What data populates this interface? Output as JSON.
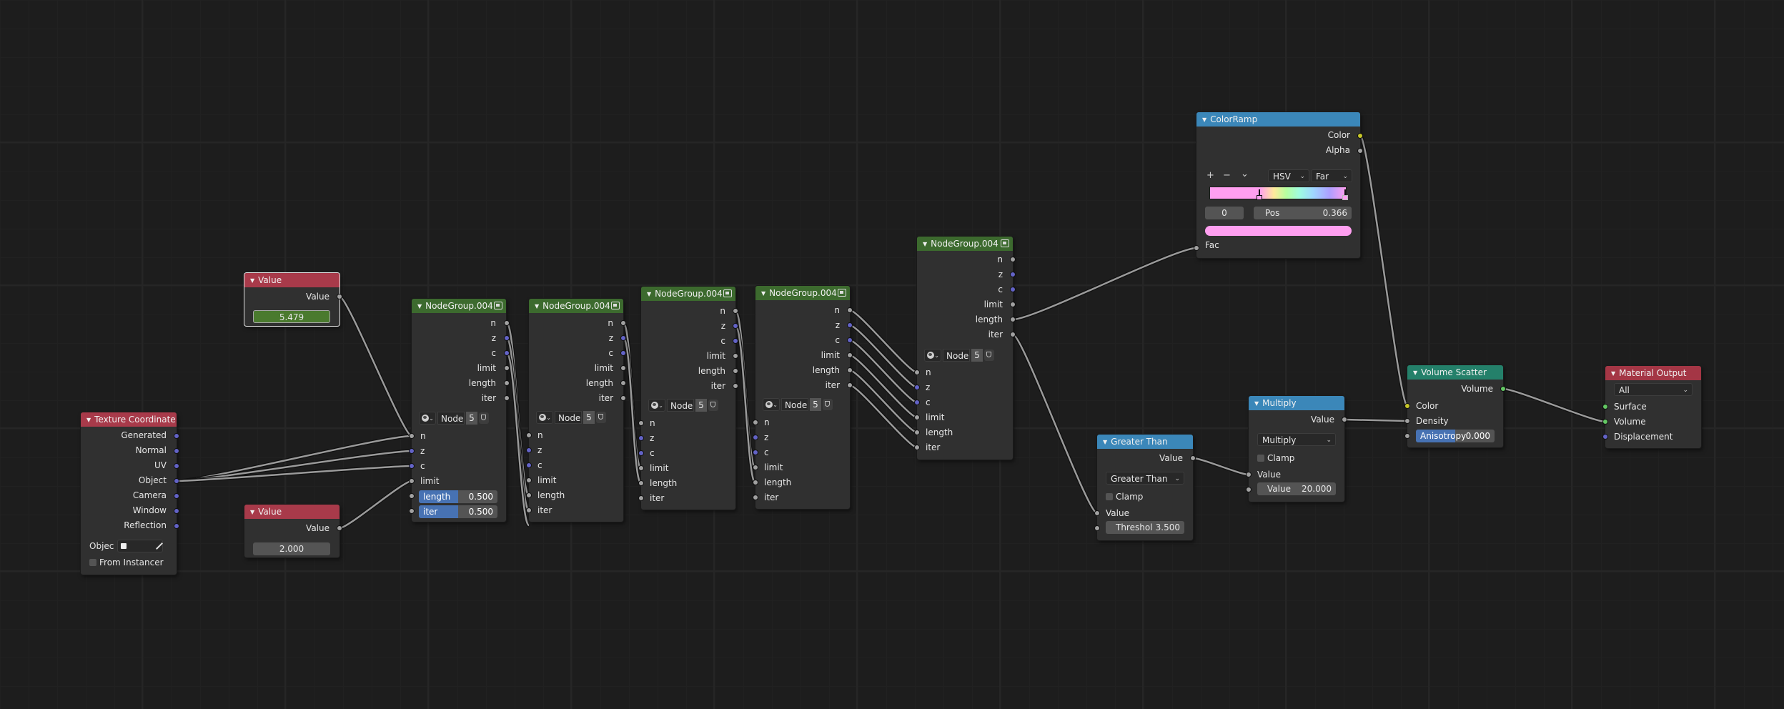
{
  "colors": {
    "input_header": "#a83a4a",
    "group_header": "#3c6a2e",
    "converter_header": "#3b87b9",
    "shader_header": "#24806a",
    "output_header": "#a43645",
    "socket_float": "#a1a1a1",
    "socket_vector": "#6363c7",
    "socket_color": "#c7c729",
    "socket_shader": "#63c763",
    "slider_fill": "#4772b3",
    "value_field_green": "#4a7a2e",
    "link": "#9a9a9a"
  },
  "texture_coordinate": {
    "title": "Texture Coordinate",
    "outputs": [
      "Generated",
      "Normal",
      "UV",
      "Object",
      "Camera",
      "Window",
      "Reflection"
    ],
    "object_label": "Objec",
    "from_instancer": "From Instancer"
  },
  "value1": {
    "title": "Value",
    "output": "Value",
    "value": "5.479"
  },
  "value2": {
    "title": "Value",
    "output": "Value",
    "value": "2.000"
  },
  "group1": {
    "title": "NodeGroup.004",
    "outputs": [
      "n",
      "z",
      "c",
      "limit",
      "length",
      "iter"
    ],
    "node_name": "Node",
    "users": "5",
    "inputs": [
      "n",
      "z",
      "c",
      "limit"
    ],
    "length_label": "length",
    "length_value": "0.500",
    "length_fill": 0.5,
    "iter_label": "iter",
    "iter_value": "0.500",
    "iter_fill": 0.5
  },
  "group2": {
    "title": "NodeGroup.004",
    "outputs": [
      "n",
      "z",
      "c",
      "limit",
      "length",
      "iter"
    ],
    "node_name": "Node",
    "users": "5",
    "inputs": [
      "n",
      "z",
      "c",
      "limit",
      "length",
      "iter"
    ]
  },
  "group3": {
    "title": "NodeGroup.004",
    "outputs": [
      "n",
      "z",
      "c",
      "limit",
      "length",
      "iter"
    ],
    "node_name": "Node",
    "users": "5",
    "inputs": [
      "n",
      "z",
      "c",
      "limit",
      "length",
      "iter"
    ]
  },
  "group4": {
    "title": "NodeGroup.004",
    "outputs": [
      "n",
      "z",
      "c",
      "limit",
      "length",
      "iter"
    ],
    "node_name": "Node",
    "users": "5",
    "inputs": [
      "n",
      "z",
      "c",
      "limit",
      "length",
      "iter"
    ]
  },
  "group5": {
    "title": "NodeGroup.004",
    "outputs": [
      "n",
      "z",
      "c",
      "limit",
      "length",
      "iter"
    ],
    "node_name": "Node",
    "users": "5",
    "inputs": [
      "n",
      "z",
      "c",
      "limit",
      "length",
      "iter"
    ]
  },
  "color_ramp": {
    "title": "ColorRamp",
    "out_color": "Color",
    "out_alpha": "Alpha",
    "plus": "+",
    "minus": "−",
    "menu": "⌄",
    "color_mode": "HSV",
    "hue_interp": "Far",
    "index": "0",
    "pos_label": "Pos",
    "pos_value": "0.366",
    "stops": [
      0.366,
      1.0
    ],
    "stop_color": "#ff9ff0",
    "in_fac": "Fac"
  },
  "greater_than": {
    "title": "Greater Than",
    "output": "Value",
    "operation": "Greater Than",
    "clamp": "Clamp",
    "input": "Value",
    "threshold_label": "Threshol",
    "threshold_value": "3.500"
  },
  "multiply": {
    "title": "Multiply",
    "output": "Value",
    "operation": "Multiply",
    "clamp": "Clamp",
    "input": "Value",
    "value_label": "Value",
    "value_value": "20.000"
  },
  "volume_scatter": {
    "title": "Volume Scatter",
    "output": "Volume",
    "in_color": "Color",
    "in_density": "Density",
    "anisotropy_label": "Anisotropy",
    "anisotropy_value": "0.000",
    "anisotropy_fill": 0.5
  },
  "material_output": {
    "title": "Material Output",
    "target": "All",
    "inputs": [
      "Surface",
      "Volume",
      "Displacement"
    ]
  }
}
